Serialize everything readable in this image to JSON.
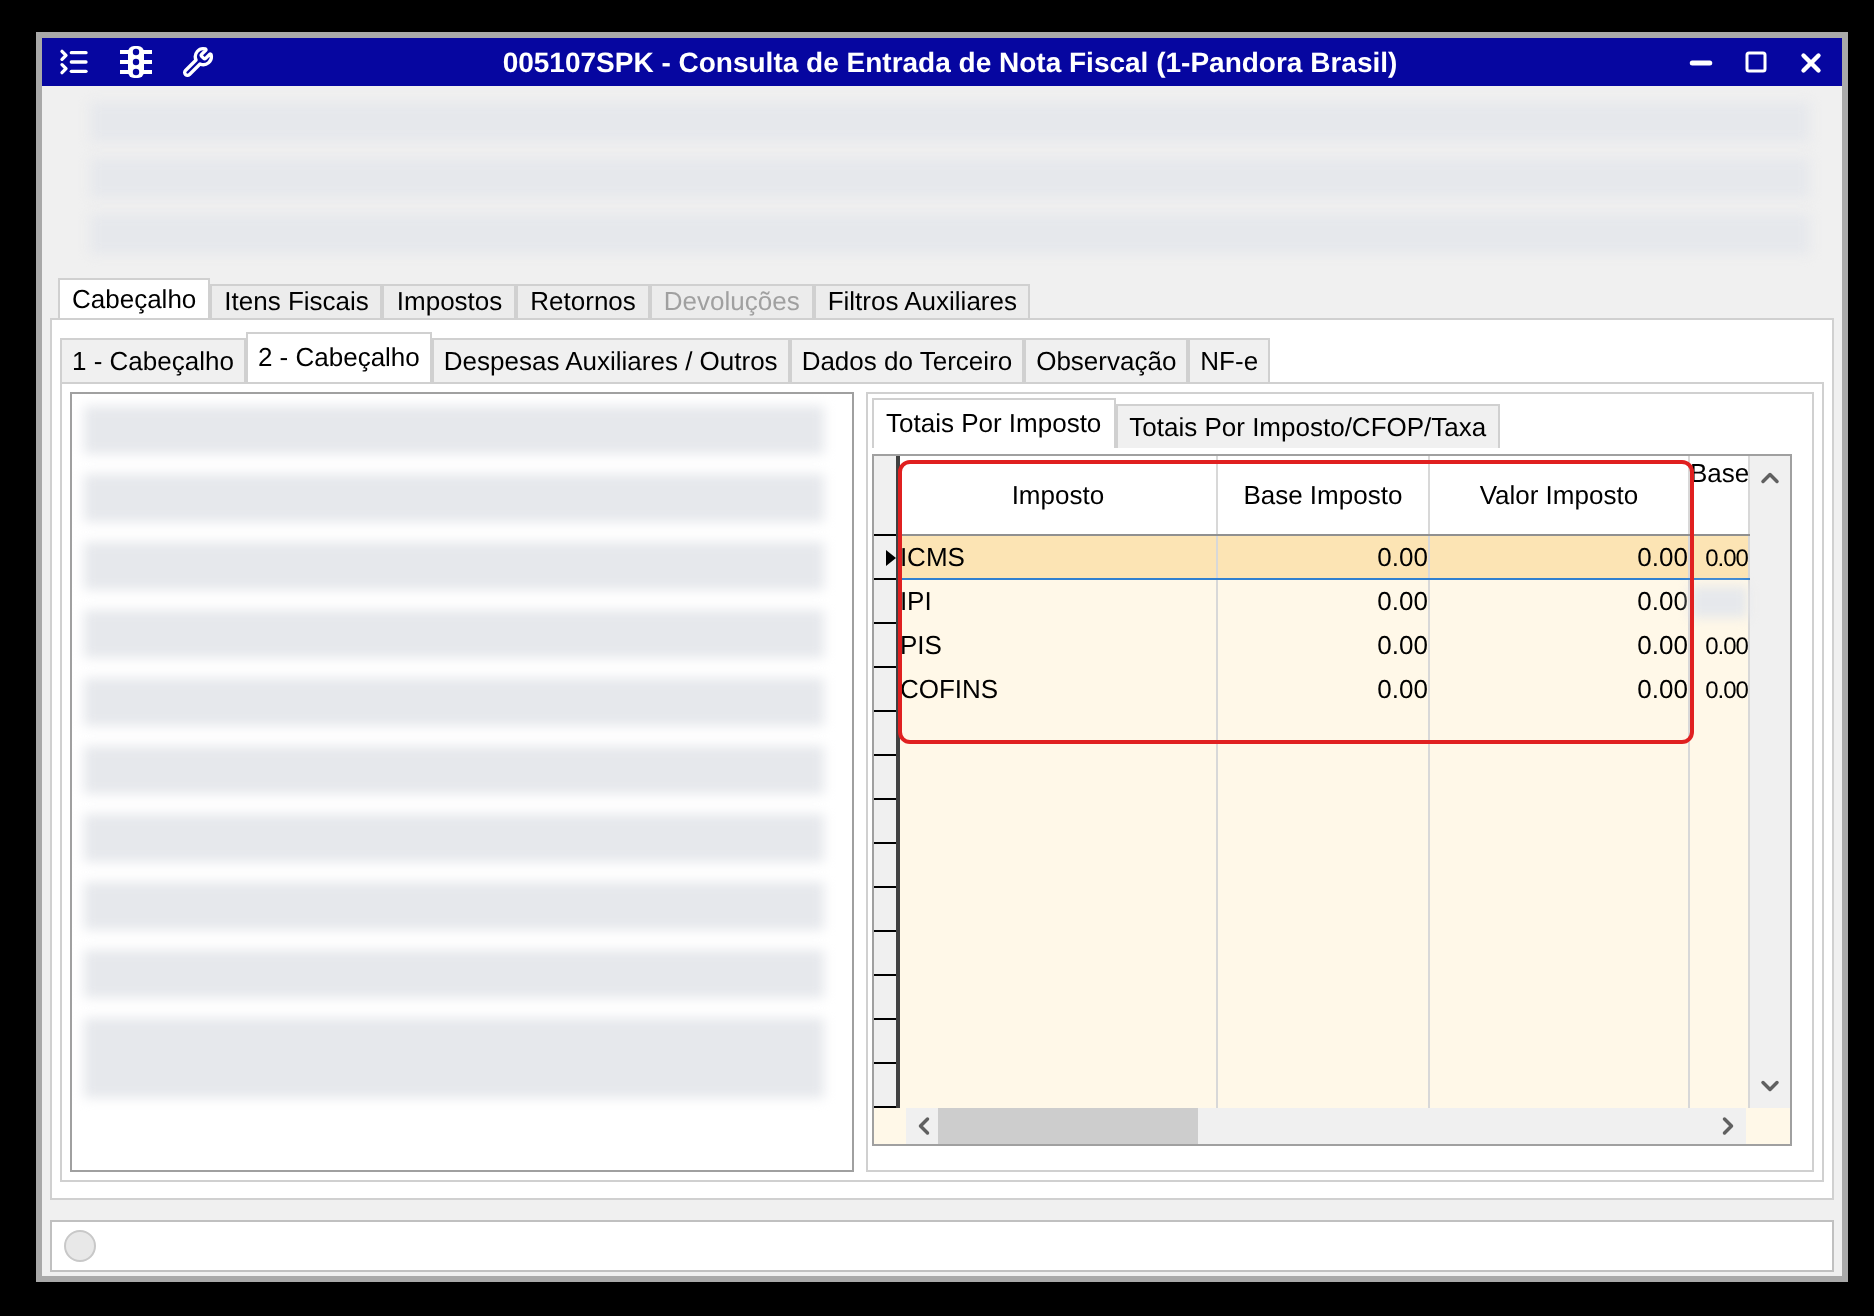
{
  "window": {
    "title": "005107SPK - Consulta de Entrada de Nota Fiscal (1-Pandora Brasil)"
  },
  "main_tabs": [
    {
      "label": "Cabeçalho",
      "selected": true,
      "disabled": false
    },
    {
      "label": "Itens Fiscais",
      "selected": false,
      "disabled": false
    },
    {
      "label": "Impostos",
      "selected": false,
      "disabled": false
    },
    {
      "label": "Retornos",
      "selected": false,
      "disabled": false
    },
    {
      "label": "Devoluções",
      "selected": false,
      "disabled": true
    },
    {
      "label": "Filtros Auxiliares",
      "selected": false,
      "disabled": false
    }
  ],
  "sub_tabs": [
    {
      "label": "1 - Cabeçalho",
      "selected": false
    },
    {
      "label": "2 - Cabeçalho",
      "selected": true
    },
    {
      "label": "Despesas Auxiliares / Outros",
      "selected": false
    },
    {
      "label": "Dados do Terceiro",
      "selected": false
    },
    {
      "label": "Observação",
      "selected": false
    },
    {
      "label": "NF-e",
      "selected": false
    }
  ],
  "totals_tabs": [
    {
      "label": "Totais Por Imposto",
      "selected": true
    },
    {
      "label": "Totais Por Imposto/CFOP/Taxa",
      "selected": false
    }
  ],
  "table": {
    "columns": [
      "Imposto",
      "Base Imposto",
      "Valor Imposto",
      "Base"
    ],
    "rows": [
      {
        "cells": [
          "ICMS",
          "0.00",
          "0.00",
          "0.00"
        ],
        "selected": true
      },
      {
        "cells": [
          "IPI",
          "0.00",
          "0.00",
          null
        ],
        "selected": false
      },
      {
        "cells": [
          "PIS",
          "0.00",
          "0.00",
          "0.00"
        ],
        "selected": false
      },
      {
        "cells": [
          "COFINS",
          "0.00",
          "0.00",
          "0.00"
        ],
        "selected": false
      }
    ]
  }
}
